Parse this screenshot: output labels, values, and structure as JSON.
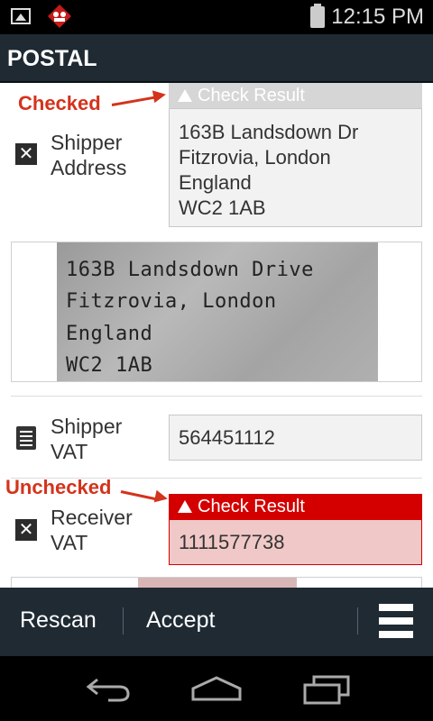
{
  "status_bar": {
    "time": "12:15 PM",
    "icons": [
      "gallery-icon",
      "app-notification-icon",
      "battery-icon"
    ]
  },
  "app_bar": {
    "title": "POSTAL"
  },
  "fields": {
    "shipper_address": {
      "label_line1": "Shipper",
      "label_line2": "Address",
      "status_icon": "x-box-icon",
      "check_header": "Check Result",
      "value": "163B Landsdown Dr\nFitzrovia, London\nEngland\nWC2 1AB",
      "scan_lines": [
        "163B Landsdown Drive",
        "Fitzrovia, London",
        "England",
        "WC2 1AB"
      ]
    },
    "shipper_vat": {
      "label_line1": "Shipper",
      "label_line2": "VAT",
      "status_icon": "document-lines-icon",
      "value": "564451112"
    },
    "receiver_vat": {
      "label_line1": "Receiver",
      "label_line2": "VAT",
      "status_icon": "x-box-icon",
      "check_header": "Check Result",
      "value": "1111577738"
    }
  },
  "annotations": {
    "checked": "Checked",
    "unchecked": "Unchecked"
  },
  "colors": {
    "checked_header_bg": "#d6d6d6",
    "unchecked_header_bg": "#d40000",
    "unchecked_value_bg": "#f1c8c8",
    "annotation": "#d4331c",
    "bar_bg": "#1f2a33"
  },
  "bottom_bar": {
    "rescan_label": "Rescan",
    "accept_label": "Accept",
    "menu_icon": "hamburger-menu-icon"
  },
  "nav_bar": {
    "icons": [
      "back-icon",
      "home-icon",
      "recent-apps-icon"
    ]
  }
}
